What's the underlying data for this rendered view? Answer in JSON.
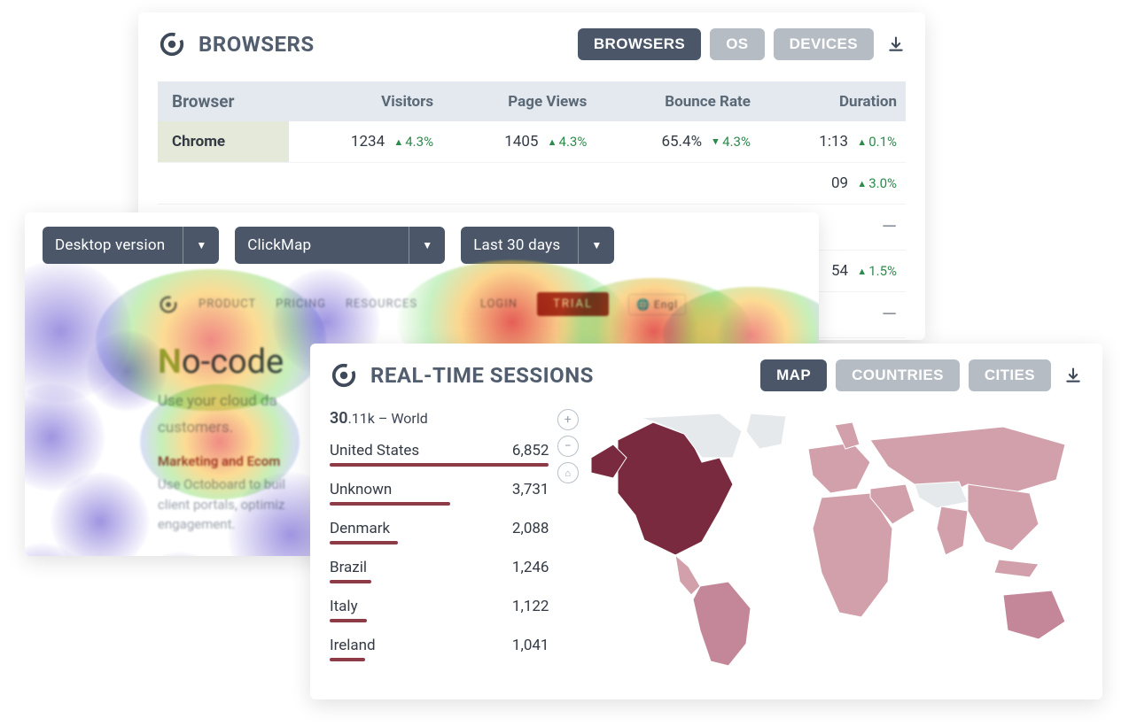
{
  "browsers_panel": {
    "title": "BROWSERS",
    "tabs": {
      "browsers": "BROWSERS",
      "os": "OS",
      "devices": "DEVICES"
    },
    "columns": {
      "browser": "Browser",
      "visitors": "Visitors",
      "pageviews": "Page Views",
      "bounce": "Bounce Rate",
      "duration": "Duration"
    },
    "rows": [
      {
        "name": "Chrome",
        "visitors": "1234",
        "visitors_delta": "4.3%",
        "visitors_dir": "up",
        "pageviews": "1405",
        "pageviews_delta": "4.3%",
        "pageviews_dir": "up",
        "bounce": "65.4%",
        "bounce_delta": "4.3%",
        "bounce_dir": "down",
        "duration": "1:13",
        "duration_delta": "0.1%",
        "duration_dir": "up"
      },
      {
        "name": "",
        "visitors": "",
        "pageviews": "",
        "bounce": "",
        "duration": "09",
        "duration_delta": "3.0%",
        "duration_dir": "up"
      },
      {
        "name": "",
        "visitors": "",
        "pageviews": "",
        "bounce": "",
        "duration": "—"
      },
      {
        "name": "",
        "visitors": "",
        "pageviews": "",
        "bounce": "",
        "duration": "54",
        "duration_delta": "1.5%",
        "duration_dir": "up"
      },
      {
        "name": "",
        "visitors": "",
        "pageviews": "",
        "bounce": "",
        "duration": "—"
      }
    ]
  },
  "heatmap_panel": {
    "filters": {
      "version": "Desktop version",
      "map_type": "ClickMap",
      "date_range": "Last 30 days"
    },
    "mock_page": {
      "nav": {
        "product": "PRODUCT",
        "pricing": "PRICING",
        "resources": "RESOURCES",
        "login": "LOGIN",
        "trial": "TRIAL",
        "lang": "Engl"
      },
      "headline_prefix": "N",
      "headline_rest": "o-code",
      "sub1": "Use your cloud da",
      "sub2": "customers.",
      "section_label": "Marketing and Ecom",
      "section_text": "Use Octoboard to buil\nclient portals, optimiz\nengagement."
    }
  },
  "sessions_panel": {
    "title": "REAL-TIME SESSIONS",
    "tabs": {
      "map": "MAP",
      "countries": "COUNTRIES",
      "cities": "CITIES"
    },
    "world_total_main": "30",
    "world_total_suffix": ".11k – World",
    "countries": [
      {
        "name": "United States",
        "value": "6,852",
        "bar_pct": 100
      },
      {
        "name": "Unknown",
        "value": "3,731",
        "bar_pct": 55
      },
      {
        "name": "Denmark",
        "value": "2,088",
        "bar_pct": 31
      },
      {
        "name": "Brazil",
        "value": "1,246",
        "bar_pct": 19
      },
      {
        "name": "Italy",
        "value": "1,122",
        "bar_pct": 17
      },
      {
        "name": "Ireland",
        "value": "1,041",
        "bar_pct": 16
      }
    ]
  },
  "colors": {
    "dark": "#4b5768",
    "muted": "#b5bcc4",
    "accent_green": "#2c8a4b",
    "map_dark": "#7a2a3e",
    "map_mid": "#c4879a",
    "map_light": "#d1a0ab"
  }
}
